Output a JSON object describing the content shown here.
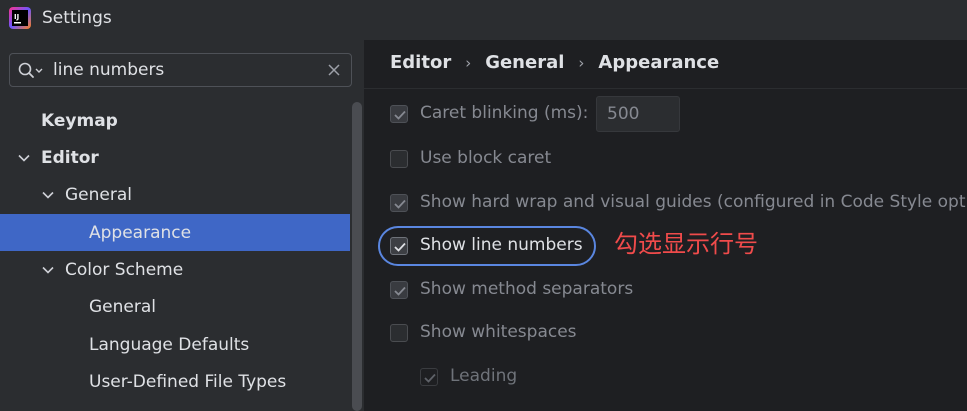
{
  "window": {
    "title": "Settings",
    "logo_text": "IJ"
  },
  "search": {
    "value": "line numbers",
    "placeholder": ""
  },
  "tree": {
    "items": [
      {
        "label": "Keymap",
        "level": 0,
        "expanded": null,
        "bold": true,
        "selected": false
      },
      {
        "label": "Editor",
        "level": 0,
        "expanded": true,
        "bold": true,
        "selected": false
      },
      {
        "label": "General",
        "level": 1,
        "expanded": true,
        "bold": false,
        "selected": false
      },
      {
        "label": "Appearance",
        "level": 2,
        "expanded": null,
        "bold": false,
        "selected": true
      },
      {
        "label": "Color Scheme",
        "level": 1,
        "expanded": true,
        "bold": false,
        "selected": false
      },
      {
        "label": "General",
        "level": 2,
        "expanded": null,
        "bold": false,
        "selected": false
      },
      {
        "label": "Language Defaults",
        "level": 2,
        "expanded": null,
        "bold": false,
        "selected": false
      },
      {
        "label": "User-Defined File Types",
        "level": 2,
        "expanded": null,
        "bold": false,
        "selected": false
      }
    ]
  },
  "breadcrumb": {
    "parts": [
      "Editor",
      "General",
      "Appearance"
    ]
  },
  "options": {
    "caret_blinking": {
      "label": "Caret blinking (ms):",
      "checked": true,
      "value": "500"
    },
    "block_caret": {
      "label": "Use block caret",
      "checked": false
    },
    "hard_wrap": {
      "label": "Show hard wrap and visual guides (configured in Code Style options)",
      "checked": true
    },
    "line_numbers": {
      "label": "Show line numbers",
      "checked": true
    },
    "method_separators": {
      "label": "Show method separators",
      "checked": true
    },
    "whitespaces": {
      "label": "Show whitespaces",
      "checked": false
    },
    "leading": {
      "label": "Leading",
      "checked": true
    }
  },
  "annotation": {
    "text": "勾选显示行号",
    "color": "#f04b4b"
  },
  "colors": {
    "selection": "#3f67c6",
    "highlight_ring": "#5a86e0"
  }
}
